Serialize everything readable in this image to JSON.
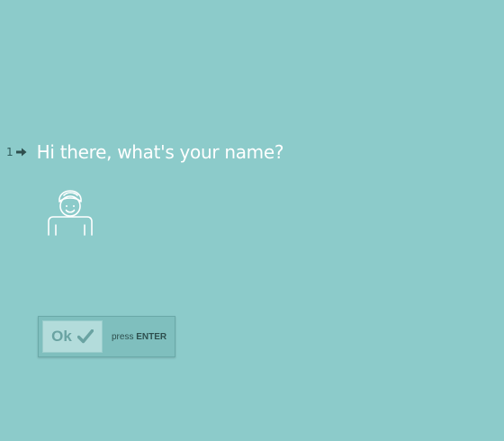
{
  "question": {
    "number": "1",
    "arrow_icon": "arrow-right-icon",
    "text": "Hi there, what's your name?"
  },
  "avatar": {
    "icon": "person-avatar-icon"
  },
  "ok": {
    "label": "Ok",
    "icon": "checkmark-icon",
    "hint_prefix": "press",
    "hint_key": "ENTER"
  },
  "colors": {
    "background": "#8ccbca",
    "text": "#ffffff",
    "button": "#b3dcdb"
  }
}
